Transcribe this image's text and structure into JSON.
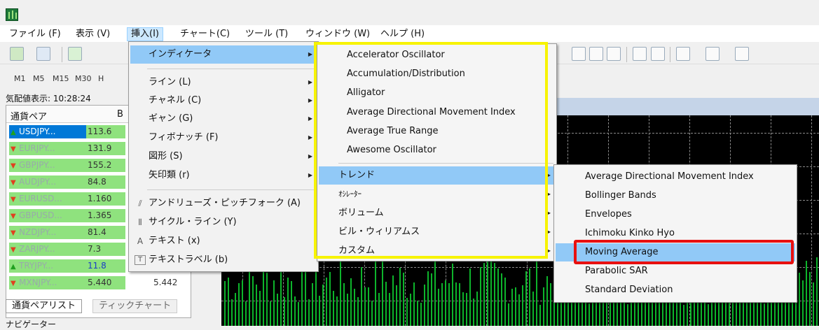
{
  "menubar": {
    "items": [
      "ファイル (F)",
      "表示 (V)",
      "挿入(I)",
      "チャート(C)",
      "ツール (T)",
      "ウィンドウ (W)",
      "ヘルプ (H)"
    ]
  },
  "timeframes": [
    "M1",
    "M5",
    "M15",
    "M30",
    "H"
  ],
  "market_watch": {
    "title": "気配値表示: 10:28:24",
    "col_symbol": "通貨ペア",
    "col_bid": "B",
    "rows": [
      {
        "symbol": "USDJPY...",
        "bid": "113.6",
        "dir": "up"
      },
      {
        "symbol": "EURJPY...",
        "bid": "131.9",
        "dir": "down"
      },
      {
        "symbol": "GBPJPY...",
        "bid": "155.2",
        "dir": "down"
      },
      {
        "symbol": "AUDJPY...",
        "bid": "84.8",
        "dir": "down"
      },
      {
        "symbol": "EURUSD...",
        "bid": "1.160",
        "dir": "down"
      },
      {
        "symbol": "GBPUSD...",
        "bid": "1.365",
        "dir": "down"
      },
      {
        "symbol": "NZDJPY...",
        "bid": "81.4",
        "dir": "down"
      },
      {
        "symbol": "ZARJPY...",
        "bid": "7.3",
        "dir": "down"
      },
      {
        "symbol": "TRYJPY...",
        "bid": "11.8",
        "dir": "up"
      },
      {
        "symbol": "MXNJPY...",
        "bid": "5.440",
        "ask": "5.442",
        "dir": "down"
      }
    ],
    "tabs": [
      "通貨ペアリスト",
      "ティックチャート"
    ]
  },
  "navigator": {
    "title": "ナビゲーター"
  },
  "insert_menu": {
    "items": [
      {
        "label": "インディケータ",
        "submenu": true,
        "highlighted": true
      },
      {
        "label": "ライン (L)",
        "submenu": true
      },
      {
        "label": "チャネル (C)",
        "submenu": true
      },
      {
        "label": "ギャン (G)",
        "submenu": true
      },
      {
        "label": "フィボナッチ (F)",
        "submenu": true
      },
      {
        "label": "図形 (S)",
        "submenu": true
      },
      {
        "label": "矢印類 (r)",
        "submenu": true
      },
      {
        "label": "アンドリューズ・ピッチフォーク (A)",
        "icon": "pitchfork-icon"
      },
      {
        "label": "サイクル・ライン (Y)",
        "icon": "cycle-lines-icon"
      },
      {
        "label": "テキスト (x)",
        "icon": "text-icon"
      },
      {
        "label": "テキストラベル (b)",
        "icon": "text-label-icon"
      }
    ]
  },
  "indicator_menu": {
    "items": [
      "Accelerator Oscillator",
      "Accumulation/Distribution",
      "Alligator",
      "Average Directional Movement Index",
      "Average True Range",
      "Awesome Oscillator"
    ],
    "groups": [
      "トレンド",
      "ｵｼﾚｰﾀｰ",
      "ボリューム",
      "ビル・ウィリアムス",
      "カスタム"
    ]
  },
  "trend_menu": {
    "items": [
      "Average Directional Movement Index",
      "Bollinger Bands",
      "Envelopes",
      "Ichimoku Kinko Hyo",
      "Moving Average",
      "Parabolic SAR",
      "Standard Deviation"
    ],
    "highlighted": "Moving Average"
  },
  "colors": {
    "highlight": "#91c9f7",
    "callout_yellow": "#f7f300",
    "callout_red": "#e81010",
    "candle_green": "#0db42b"
  }
}
